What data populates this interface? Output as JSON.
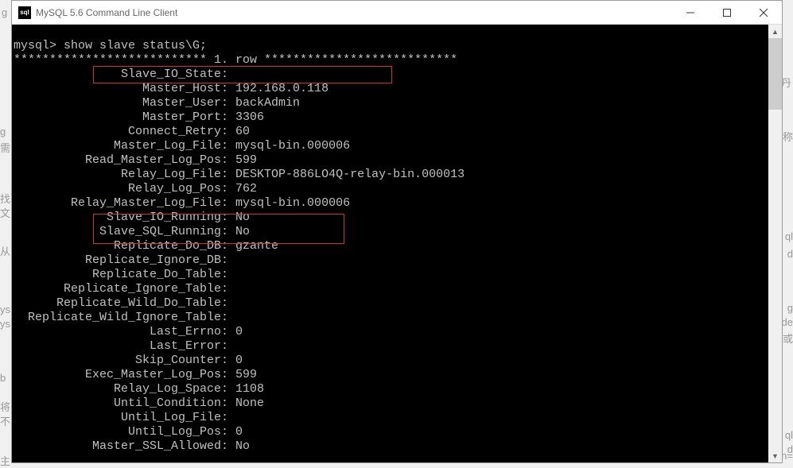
{
  "window": {
    "title": "MySQL 5.6 Command Line Client",
    "icon_text": "sql"
  },
  "terminal": {
    "prompt": "mysql> ",
    "command": "show slave status\\G;",
    "row_header": "*************************** 1. row ***************************",
    "fields": [
      {
        "label": "Slave_IO_State:",
        "value": ""
      },
      {
        "label": "Master_Host:",
        "value": "192.168.0.118"
      },
      {
        "label": "Master_User:",
        "value": "backAdmin"
      },
      {
        "label": "Master_Port:",
        "value": "3306"
      },
      {
        "label": "Connect_Retry:",
        "value": "60"
      },
      {
        "label": "Master_Log_File:",
        "value": "mysql-bin.000006"
      },
      {
        "label": "Read_Master_Log_Pos:",
        "value": "599"
      },
      {
        "label": "Relay_Log_File:",
        "value": "DESKTOP-886LO4Q-relay-bin.000013"
      },
      {
        "label": "Relay_Log_Pos:",
        "value": "762"
      },
      {
        "label": "Relay_Master_Log_File:",
        "value": "mysql-bin.000006"
      },
      {
        "label": "Slave_IO_Running:",
        "value": "No"
      },
      {
        "label": "Slave_SQL_Running:",
        "value": "No"
      },
      {
        "label": "Replicate_Do_DB:",
        "value": "gzante"
      },
      {
        "label": "Replicate_Ignore_DB:",
        "value": ""
      },
      {
        "label": "Replicate_Do_Table:",
        "value": ""
      },
      {
        "label": "Replicate_Ignore_Table:",
        "value": ""
      },
      {
        "label": "Replicate_Wild_Do_Table:",
        "value": ""
      },
      {
        "label": "Replicate_Wild_Ignore_Table:",
        "value": ""
      },
      {
        "label": "Last_Errno:",
        "value": "0"
      },
      {
        "label": "Last_Error:",
        "value": ""
      },
      {
        "label": "Skip_Counter:",
        "value": "0"
      },
      {
        "label": "Exec_Master_Log_Pos:",
        "value": "599"
      },
      {
        "label": "Relay_Log_Space:",
        "value": "1108"
      },
      {
        "label": "Until_Condition:",
        "value": "None"
      },
      {
        "label": "Until_Log_File:",
        "value": ""
      },
      {
        "label": "Until_Log_Pos:",
        "value": "0"
      },
      {
        "label": "Master_SSL_Allowed:",
        "value": "No"
      }
    ]
  },
  "bg": {
    "t1": "g",
    "t2": "需",
    "t3": "找",
    "t4": "文",
    "t5": "从",
    "t6": "ys",
    "t7": "ys",
    "t8": "b",
    "t9": "将",
    "t10": "不",
    "t11": "主",
    "r1": "丹",
    "r2": "称",
    "r3": "ql",
    "r4": "d",
    "r5": "g",
    "r6": "de",
    "r7": "或",
    "r8": "ql",
    "r9": "d",
    "r10": "log-bin="
  }
}
